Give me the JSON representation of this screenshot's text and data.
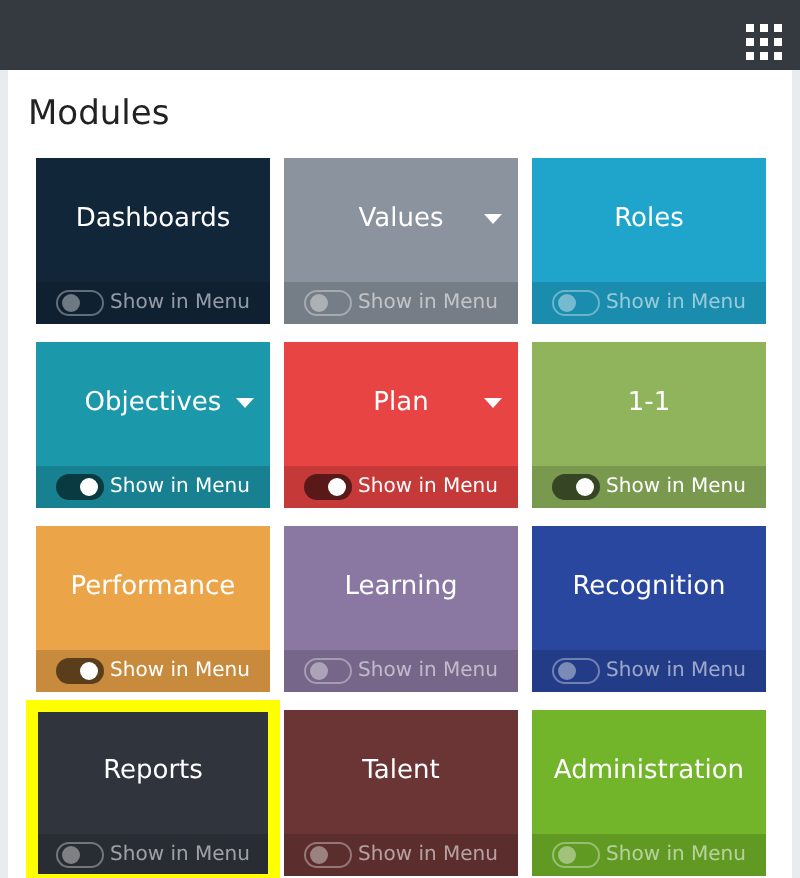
{
  "heading": "Modules",
  "modules": [
    {
      "title": "Dashboards",
      "color": "#12263a",
      "dropdown": false,
      "show_in_menu": false,
      "toggle_label": "Show in Menu",
      "highlighted": false
    },
    {
      "title": "Values",
      "color": "#8a939e",
      "dropdown": true,
      "show_in_menu": false,
      "toggle_label": "Show in Menu",
      "highlighted": false
    },
    {
      "title": "Roles",
      "color": "#1fa5cc",
      "dropdown": false,
      "show_in_menu": false,
      "toggle_label": "Show in Menu",
      "highlighted": false
    },
    {
      "title": "Objectives",
      "color": "#1c98ab",
      "dropdown": true,
      "show_in_menu": true,
      "toggle_label": "Show in Menu",
      "highlighted": false
    },
    {
      "title": "Plan",
      "color": "#e84444",
      "dropdown": true,
      "show_in_menu": true,
      "toggle_label": "Show in Menu",
      "highlighted": false
    },
    {
      "title": "1-1",
      "color": "#8fb45c",
      "dropdown": false,
      "show_in_menu": true,
      "toggle_label": "Show in Menu",
      "highlighted": false
    },
    {
      "title": "Performance",
      "color": "#eca448",
      "dropdown": false,
      "show_in_menu": true,
      "toggle_label": "Show in Menu",
      "highlighted": false
    },
    {
      "title": "Learning",
      "color": "#8a78a3",
      "dropdown": false,
      "show_in_menu": false,
      "toggle_label": "Show in Menu",
      "highlighted": false
    },
    {
      "title": "Recognition",
      "color": "#2a47a0",
      "dropdown": false,
      "show_in_menu": false,
      "toggle_label": "Show in Menu",
      "highlighted": false
    },
    {
      "title": "Reports",
      "color": "#30343c",
      "dropdown": false,
      "show_in_menu": false,
      "toggle_label": "Show in Menu",
      "highlighted": true
    },
    {
      "title": "Talent",
      "color": "#6b3535",
      "dropdown": false,
      "show_in_menu": false,
      "toggle_label": "Show in Menu",
      "highlighted": false
    },
    {
      "title": "Administration",
      "color": "#73b52a",
      "dropdown": false,
      "show_in_menu": false,
      "toggle_label": "Show in Menu",
      "highlighted": false
    }
  ]
}
